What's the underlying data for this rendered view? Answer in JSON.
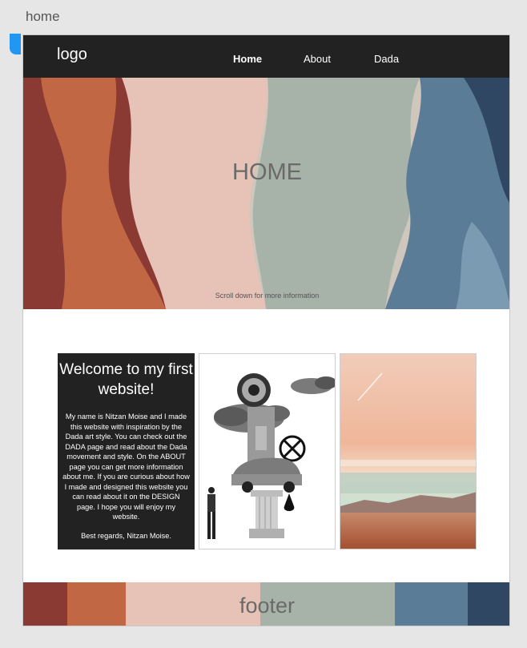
{
  "frame": {
    "label": "home"
  },
  "nav": {
    "logo": "logo",
    "links": [
      {
        "label": "Home",
        "active": true
      },
      {
        "label": "About"
      },
      {
        "label": "Dada"
      }
    ]
  },
  "hero": {
    "title": "HOME",
    "subtitle": "Scroll down for more information"
  },
  "welcome": {
    "title": "Welcome to my first website!",
    "body": "My name is Nitzan Moise and I made this website with inspiration by the Dada art style. You can check out the DADA page and read about the Dada movement and style. On the ABOUT page you can get more information about me. If you are curious about how I made and designed this website you can read about it on the DESIGN page. I hope you will enjoy my website.",
    "signature": "Best regards, Nitzan Moise."
  },
  "images": {
    "collage": "dada-collage-image",
    "desert": "desert-sunset-image"
  },
  "footer": {
    "text": "footer"
  },
  "colors": {
    "navbar": "#222222",
    "accent_handle": "#2196f3",
    "card_dark": "#222222"
  }
}
